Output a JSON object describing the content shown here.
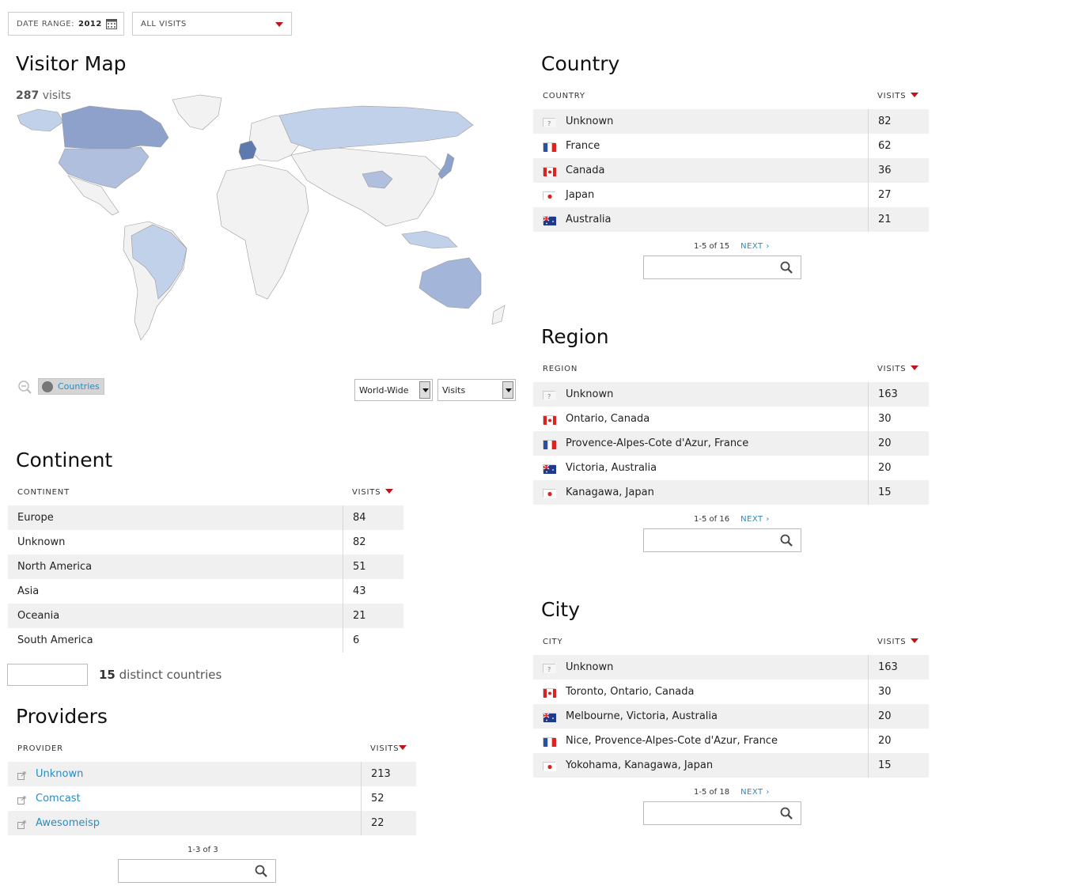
{
  "toolbar": {
    "date_range_label": "DATE RANGE:",
    "date_range_value": "2012",
    "segment_value": "ALL VISITS"
  },
  "visitor_map": {
    "title": "Visitor Map",
    "visits_count": "287",
    "visits_label": "visits",
    "countries_button": "Countries",
    "scope_select": "World-Wide",
    "metric_select": "Visits"
  },
  "colors": {
    "accent_red": "#c0141b",
    "link_blue": "#2a8bc0",
    "map_dark": "#5e78b0",
    "map_mid": "#8ea1cb",
    "map_light": "#c2d1ea",
    "map_none": "#f2f2f2"
  },
  "continent": {
    "title": "Continent",
    "col_label": "CONTINENT",
    "col_value": "VISITS",
    "rows": [
      {
        "label": "Europe",
        "value": "84"
      },
      {
        "label": "Unknown",
        "value": "82"
      },
      {
        "label": "North America",
        "value": "51"
      },
      {
        "label": "Asia",
        "value": "43"
      },
      {
        "label": "Oceania",
        "value": "21"
      },
      {
        "label": "South America",
        "value": "6"
      }
    ],
    "distinct_count": "15",
    "distinct_label": "distinct countries"
  },
  "providers": {
    "title": "Providers",
    "col_label": "PROVIDER",
    "col_value": "VISITS",
    "rows": [
      {
        "label": "Unknown",
        "value": "213"
      },
      {
        "label": "Comcast",
        "value": "52"
      },
      {
        "label": "Awesomeisp",
        "value": "22"
      }
    ],
    "pager": "1-3 of 3"
  },
  "country": {
    "title": "Country",
    "col_label": "COUNTRY",
    "col_value": "VISITS",
    "rows": [
      {
        "label": "Unknown",
        "value": "82",
        "flag": "unknown"
      },
      {
        "label": "France",
        "value": "62",
        "flag": "fr"
      },
      {
        "label": "Canada",
        "value": "36",
        "flag": "ca"
      },
      {
        "label": "Japan",
        "value": "27",
        "flag": "jp"
      },
      {
        "label": "Australia",
        "value": "21",
        "flag": "au"
      }
    ],
    "pager": "1-5 of 15",
    "next": "NEXT ›"
  },
  "region": {
    "title": "Region",
    "col_label": "REGION",
    "col_value": "VISITS",
    "rows": [
      {
        "label": "Unknown",
        "value": "163",
        "flag": "unknown"
      },
      {
        "label": "Ontario, Canada",
        "value": "30",
        "flag": "ca"
      },
      {
        "label": "Provence-Alpes-Cote d'Azur, France",
        "value": "20",
        "flag": "fr"
      },
      {
        "label": "Victoria, Australia",
        "value": "20",
        "flag": "au"
      },
      {
        "label": "Kanagawa, Japan",
        "value": "15",
        "flag": "jp"
      }
    ],
    "pager": "1-5 of 16",
    "next": "NEXT ›"
  },
  "city": {
    "title": "City",
    "col_label": "CITY",
    "col_value": "VISITS",
    "rows": [
      {
        "label": "Unknown",
        "value": "163",
        "flag": "unknown"
      },
      {
        "label": "Toronto, Ontario, Canada",
        "value": "30",
        "flag": "ca"
      },
      {
        "label": "Melbourne, Victoria, Australia",
        "value": "20",
        "flag": "au"
      },
      {
        "label": "Nice, Provence-Alpes-Cote d'Azur, France",
        "value": "20",
        "flag": "fr"
      },
      {
        "label": "Yokohama, Kanagawa, Japan",
        "value": "15",
        "flag": "jp"
      }
    ],
    "pager": "1-5 of 18",
    "next": "NEXT ›"
  }
}
